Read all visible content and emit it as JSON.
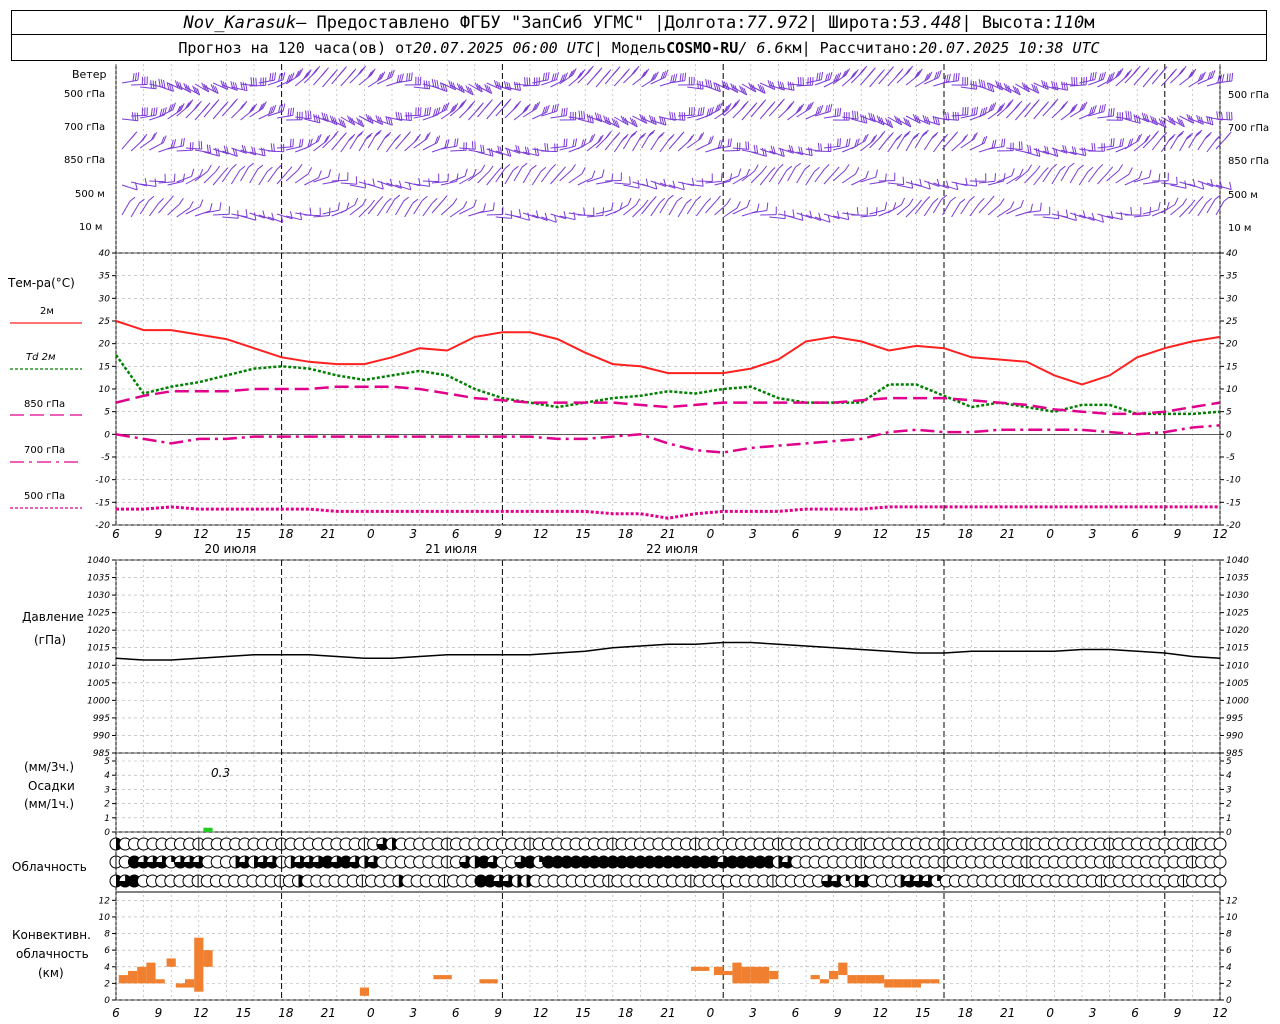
{
  "header": {
    "station": "Nov_Karasuk",
    "provided": " – Предоставлено ФГБУ \"ЗапСиб УГМС\" | ",
    "lon_label": "Долгота: ",
    "lon": "77.972",
    "lat_label": " | Широта: ",
    "lat": "53.448",
    "alt_label": " | Высота: ",
    "alt": "110",
    "alt_unit": "м",
    "forecast_label": "Прогноз на 120 часа(ов) от ",
    "forecast_time": "20.07.2025 06:00 UTC",
    "model_label": " | Модель ",
    "model": "COSMO-RU",
    "res": " / 6.6",
    "res_unit": "км",
    "calc_label": " | Рассчитано: ",
    "calc_time": "20.07.2025 10:38 UTC"
  },
  "wind_panel": {
    "title": "Ветер",
    "levels": [
      "500 гПа",
      "700 гПа",
      "850 гПа",
      "500 м",
      "10  м"
    ]
  },
  "temp_panel": {
    "title": "Тем-ра(°C)",
    "legend": [
      {
        "label": "2м",
        "color": "#ff2020",
        "style": "solid"
      },
      {
        "label": "Td  2м",
        "color": "#008000",
        "style": "dotted"
      },
      {
        "label": "850 гПа",
        "color": "#e0008c",
        "style": "dash"
      },
      {
        "label": "700 гПа",
        "color": "#e0008c",
        "style": "dashdot"
      },
      {
        "label": "500 гПа",
        "color": "#e0008c",
        "style": "dot"
      }
    ]
  },
  "pressure_panel": {
    "title1": "Давление",
    "title2": "(гПа)"
  },
  "precip_panel": {
    "title1": "(мм/3ч.)",
    "title2": "Осадки",
    "title3": "(мм/1ч.)",
    "annotation": "0.3"
  },
  "cloud_panel": {
    "title": "Облачность"
  },
  "conv_panel": {
    "title1": "Конвективн.",
    "title2": "облачность",
    "title3": "(км)"
  },
  "time_axis": {
    "hour_labels": [
      "6",
      "9",
      "12",
      "15",
      "18",
      "21",
      "0",
      "3",
      "6",
      "9",
      "12",
      "15",
      "18",
      "21",
      "0",
      "3",
      "6",
      "9",
      "12",
      "15",
      "18",
      "21",
      "0",
      "3",
      "6",
      "9",
      "12"
    ],
    "day_labels": [
      "20 июля",
      "21 июля",
      "22 июля"
    ]
  },
  "chart_data": [
    {
      "type": "line",
      "name": "temperature",
      "x_hours_from_start": [
        0,
        3,
        6,
        9,
        12,
        15,
        18,
        21,
        24,
        27,
        30,
        33,
        36,
        39,
        42,
        45,
        48,
        51,
        54,
        57,
        60,
        63,
        66,
        69,
        72,
        75,
        78,
        81,
        84,
        87,
        90,
        93,
        96,
        99,
        102,
        105,
        108,
        111,
        114,
        117,
        120
      ],
      "ylim": [
        -20,
        40
      ],
      "yticks": [
        -20,
        -15,
        -10,
        -5,
        0,
        5,
        10,
        15,
        20,
        25,
        30,
        35,
        40
      ],
      "series": [
        {
          "name": "2м",
          "values": [
            25,
            23,
            23,
            22,
            21,
            19,
            17,
            16,
            15.5,
            15.5,
            17,
            19,
            18.5,
            21.5,
            22.5,
            22.5,
            21,
            18,
            15.5,
            15,
            13.5,
            13.5,
            13.5,
            14.5,
            16.5,
            20.5,
            21.5,
            20.5,
            18.5,
            19.5,
            19,
            17,
            16.5,
            16,
            13,
            11,
            13,
            17,
            19,
            20.5,
            21.5
          ]
        },
        {
          "name": "Td  2м",
          "values": [
            17.5,
            9,
            10.5,
            11.5,
            13,
            14.5,
            15,
            14.5,
            13,
            12,
            13,
            14,
            13,
            10,
            8,
            7,
            6,
            7,
            8,
            8.5,
            9.5,
            9,
            10,
            10.5,
            8,
            7,
            7,
            7,
            11,
            11,
            8.5,
            6,
            7,
            6,
            5,
            6.5,
            6.5,
            4.5,
            4.5,
            4.5,
            5
          ]
        },
        {
          "name": "850 гПа",
          "values": [
            7,
            8.5,
            9.5,
            9.5,
            9.5,
            10,
            10,
            10,
            10.5,
            10.5,
            10.5,
            10,
            9,
            8,
            7.5,
            7,
            7,
            7,
            7,
            6.5,
            6,
            6.5,
            7,
            7,
            7,
            7,
            7,
            7.5,
            8,
            8,
            8,
            7.5,
            7,
            6.5,
            5.5,
            5,
            4.5,
            4.5,
            5,
            6,
            7
          ]
        },
        {
          "name": "700 гПа",
          "values": [
            0,
            -1,
            -2,
            -1,
            -1,
            -0.5,
            -0.5,
            -0.5,
            -0.5,
            -0.5,
            -0.5,
            -0.5,
            -0.5,
            -0.5,
            -0.5,
            -0.5,
            -1,
            -1,
            -0.5,
            0,
            -2,
            -3.5,
            -4,
            -3,
            -2.5,
            -2,
            -1.5,
            -1,
            0.5,
            1,
            0.5,
            0.5,
            1,
            1,
            1,
            1,
            0.5,
            0,
            0.5,
            1.5,
            2
          ]
        },
        {
          "name": "500 гПа",
          "values": [
            -16.5,
            -16.5,
            -16,
            -16.5,
            -16.5,
            -16.5,
            -16.5,
            -16.5,
            -17,
            -17,
            -17,
            -17,
            -17,
            -17,
            -17,
            -17,
            -17,
            -17,
            -17.5,
            -17.5,
            -18.5,
            -17.5,
            -17,
            -17,
            -17,
            -16.5,
            -16.5,
            -16.5,
            -16,
            -16,
            -16,
            -16,
            -16,
            -16,
            -16,
            -16,
            -16,
            -16,
            -16,
            -16,
            -16
          ]
        }
      ]
    },
    {
      "type": "line",
      "name": "pressure",
      "x_hours_from_start": [
        0,
        3,
        6,
        9,
        12,
        15,
        18,
        21,
        24,
        27,
        30,
        33,
        36,
        39,
        42,
        45,
        48,
        51,
        54,
        57,
        60,
        63,
        66,
        69,
        72,
        75,
        78,
        81,
        84,
        87,
        90,
        93,
        96,
        99,
        102,
        105,
        108,
        111,
        114,
        117,
        120
      ],
      "ylim": [
        985,
        1040
      ],
      "yticks": [
        985,
        990,
        995,
        1000,
        1005,
        1010,
        1015,
        1020,
        1025,
        1030,
        1035,
        1040
      ],
      "series": [
        {
          "name": "pressure",
          "values": [
            1012,
            1011.5,
            1011.5,
            1012,
            1012.5,
            1013,
            1013,
            1013,
            1012.5,
            1012,
            1012,
            1012.5,
            1013,
            1013,
            1013,
            1013,
            1013.5,
            1014,
            1015,
            1015.5,
            1016,
            1016,
            1016.5,
            1016.5,
            1016,
            1015.5,
            1015,
            1014.5,
            1014,
            1013.5,
            1013.5,
            1014,
            1014,
            1014,
            1014,
            1014.5,
            1014.5,
            1014,
            1013.5,
            1012.5,
            1012
          ]
        }
      ]
    },
    {
      "type": "bar",
      "name": "precipitation",
      "ylim": [
        0,
        5
      ],
      "yticks": [
        0,
        1,
        2,
        3,
        4,
        5
      ],
      "bars": [
        {
          "x_hour": 9.5,
          "width_hours": 1,
          "value": 0.3,
          "color": "#22cc22"
        }
      ]
    },
    {
      "type": "bar",
      "name": "convective_cloud",
      "ylim": [
        0,
        13
      ],
      "yticks": [
        0,
        2,
        4,
        6,
        8,
        10,
        12
      ],
      "bars": [
        {
          "x_hour": 0.3,
          "width_hours": 1,
          "base": 2,
          "top": 3,
          "color": "#f08030"
        },
        {
          "x_hour": 1.3,
          "width_hours": 1,
          "base": 2,
          "top": 3.5,
          "color": "#f08030"
        },
        {
          "x_hour": 2.3,
          "width_hours": 1,
          "base": 2,
          "top": 4,
          "color": "#f08030"
        },
        {
          "x_hour": 3.3,
          "width_hours": 1,
          "base": 2,
          "top": 4.5,
          "color": "#f08030"
        },
        {
          "x_hour": 4.3,
          "width_hours": 1,
          "base": 2,
          "top": 2.5,
          "color": "#f08030"
        },
        {
          "x_hour": 5.5,
          "width_hours": 1,
          "base": 4,
          "top": 5,
          "color": "#f08030"
        },
        {
          "x_hour": 6.5,
          "width_hours": 1,
          "base": 1.5,
          "top": 2,
          "color": "#f08030"
        },
        {
          "x_hour": 7.5,
          "width_hours": 1,
          "base": 1.5,
          "top": 2.5,
          "color": "#f08030"
        },
        {
          "x_hour": 8.5,
          "width_hours": 1,
          "base": 1,
          "top": 7.5,
          "color": "#f08030"
        },
        {
          "x_hour": 9.5,
          "width_hours": 1,
          "base": 4,
          "top": 6,
          "color": "#f08030"
        },
        {
          "x_hour": 26.5,
          "width_hours": 1,
          "base": 0.5,
          "top": 1.5,
          "color": "#f08030"
        },
        {
          "x_hour": 34.5,
          "width_hours": 2,
          "base": 2.5,
          "top": 3,
          "color": "#f08030"
        },
        {
          "x_hour": 39.5,
          "width_hours": 2,
          "base": 2,
          "top": 2.5,
          "color": "#f08030"
        },
        {
          "x_hour": 62.5,
          "width_hours": 2,
          "base": 3.5,
          "top": 4,
          "color": "#f08030"
        },
        {
          "x_hour": 65,
          "width_hours": 1,
          "base": 3,
          "top": 4,
          "color": "#f08030"
        },
        {
          "x_hour": 66,
          "width_hours": 1,
          "base": 3,
          "top": 3.5,
          "color": "#f08030"
        },
        {
          "x_hour": 67,
          "width_hours": 1,
          "base": 2,
          "top": 4.5,
          "color": "#f08030"
        },
        {
          "x_hour": 68,
          "width_hours": 1,
          "base": 2,
          "top": 4,
          "color": "#f08030"
        },
        {
          "x_hour": 69,
          "width_hours": 1,
          "base": 2,
          "top": 4,
          "color": "#f08030"
        },
        {
          "x_hour": 70,
          "width_hours": 1,
          "base": 2,
          "top": 4,
          "color": "#f08030"
        },
        {
          "x_hour": 71,
          "width_hours": 1,
          "base": 2.5,
          "top": 3.5,
          "color": "#f08030"
        },
        {
          "x_hour": 75.5,
          "width_hours": 1,
          "base": 2.5,
          "top": 3,
          "color": "#f08030"
        },
        {
          "x_hour": 76.5,
          "width_hours": 1,
          "base": 2,
          "top": 2.5,
          "color": "#f08030"
        },
        {
          "x_hour": 77.5,
          "width_hours": 1,
          "base": 2.5,
          "top": 3.5,
          "color": "#f08030"
        },
        {
          "x_hour": 78.5,
          "width_hours": 1,
          "base": 3,
          "top": 4.5,
          "color": "#f08030"
        },
        {
          "x_hour": 79.5,
          "width_hours": 1,
          "base": 2,
          "top": 3,
          "color": "#f08030"
        },
        {
          "x_hour": 80.5,
          "width_hours": 1,
          "base": 2,
          "top": 3,
          "color": "#f08030"
        },
        {
          "x_hour": 81.5,
          "width_hours": 1,
          "base": 2,
          "top": 3,
          "color": "#f08030"
        },
        {
          "x_hour": 82.5,
          "width_hours": 1,
          "base": 2,
          "top": 3,
          "color": "#f08030"
        },
        {
          "x_hour": 83.5,
          "width_hours": 1,
          "base": 1.5,
          "top": 2.5,
          "color": "#f08030"
        },
        {
          "x_hour": 84.5,
          "width_hours": 1,
          "base": 1.5,
          "top": 2.5,
          "color": "#f08030"
        },
        {
          "x_hour": 85.5,
          "width_hours": 1,
          "base": 1.5,
          "top": 2.5,
          "color": "#f08030"
        },
        {
          "x_hour": 86.5,
          "width_hours": 1,
          "base": 1.5,
          "top": 2.5,
          "color": "#f08030"
        },
        {
          "x_hour": 87.5,
          "width_hours": 1,
          "base": 2,
          "top": 2.5,
          "color": "#f08030"
        },
        {
          "x_hour": 88.5,
          "width_hours": 1,
          "base": 2,
          "top": 2.5,
          "color": "#f08030"
        }
      ]
    },
    {
      "type": "table",
      "name": "cloud_cover",
      "rows": [
        "upper",
        "middle",
        "lower"
      ],
      "cover_fraction": {
        "upper": [
          0.5,
          0,
          0,
          0,
          0,
          0,
          0,
          0,
          0,
          0,
          0,
          0,
          0,
          0,
          0,
          0,
          0,
          0,
          0,
          0,
          0,
          0,
          0,
          0,
          0,
          0,
          0,
          0,
          0,
          0.75,
          0.5,
          0,
          0,
          0,
          0,
          0,
          0,
          0,
          0,
          0,
          0,
          0,
          0,
          0,
          0,
          0,
          0,
          0,
          0,
          0,
          0,
          0,
          0,
          0,
          0,
          0,
          0,
          0,
          0,
          0,
          0,
          0,
          0,
          0,
          0,
          0,
          0,
          0,
          0,
          0,
          0,
          0,
          0,
          0,
          0,
          0,
          0,
          0,
          0,
          0,
          0,
          0,
          0,
          0,
          0,
          0,
          0,
          0,
          0,
          0,
          0,
          0,
          0,
          0,
          0,
          0,
          0,
          0,
          0,
          0,
          0,
          0,
          0,
          0,
          0,
          0,
          0,
          0,
          0,
          0,
          0,
          0,
          0,
          0,
          0,
          0,
          0,
          0,
          0,
          0,
          0
        ],
        "middle": [
          0,
          0,
          1,
          0.75,
          0.75,
          0.75,
          0.25,
          0.75,
          0.75,
          0.75,
          0,
          0,
          0,
          0.5,
          0.75,
          0.5,
          0.75,
          0.75,
          0,
          0.5,
          0.75,
          0.75,
          0.75,
          1,
          0.75,
          1,
          0.75,
          0.5,
          0.75,
          0,
          0,
          0,
          0,
          0,
          0,
          0,
          0,
          0,
          0.75,
          0.5,
          1,
          0.75,
          0,
          0,
          0.75,
          1,
          0.25,
          1,
          1,
          1,
          1,
          1,
          1,
          1,
          1,
          1,
          1,
          1,
          1,
          1,
          1,
          1,
          1,
          1,
          1,
          1,
          0.75,
          1,
          1,
          1,
          1,
          1,
          0.5,
          0.75,
          0,
          0,
          0,
          0,
          0,
          0,
          0,
          0,
          0,
          0,
          0,
          0,
          0,
          0,
          0,
          0,
          0,
          0,
          0,
          0,
          0,
          0,
          0,
          0,
          0,
          0,
          0,
          0,
          0,
          0,
          0,
          0,
          0,
          0,
          0,
          0,
          0,
          0,
          0,
          0,
          0,
          0,
          0,
          0,
          0,
          0,
          0
        ],
        "lower": [
          0.5,
          0.75,
          1,
          0,
          0,
          0,
          0,
          0,
          0,
          0,
          0,
          0,
          0,
          0,
          0,
          0,
          0,
          0,
          0,
          0,
          0.5,
          0,
          0,
          0,
          0,
          0,
          0,
          0,
          0,
          0,
          0,
          0.5,
          0,
          0,
          0,
          0,
          0,
          0,
          0,
          0,
          1,
          1,
          0.75,
          0.75,
          0.5,
          0.5,
          0,
          0,
          0,
          0,
          0,
          0,
          0,
          0,
          0,
          0,
          0,
          0,
          0,
          0,
          0,
          0,
          0,
          0,
          0,
          0,
          0,
          0,
          0,
          0,
          0,
          0,
          0,
          0,
          0,
          0,
          0,
          0,
          0.75,
          0.75,
          0.25,
          0.5,
          0.75,
          0,
          0,
          0,
          0.5,
          0.75,
          0.75,
          0.75,
          0.25,
          0,
          0,
          0,
          0,
          0,
          0,
          0,
          0,
          0,
          0,
          0,
          0,
          0,
          0,
          0,
          0,
          0,
          0,
          0,
          0,
          0,
          0,
          0,
          0,
          0,
          0,
          0,
          0,
          0,
          0,
          0
        ]
      }
    }
  ],
  "colors": {
    "wind_barb": "#7a3ad6",
    "grid": "#aaaaaa",
    "temp_2m": "#ff2020",
    "dewpoint": "#008000",
    "upper_temp": "#e0008c",
    "pressure": "#000000",
    "precip": "#22cc22",
    "convective": "#f08030"
  }
}
